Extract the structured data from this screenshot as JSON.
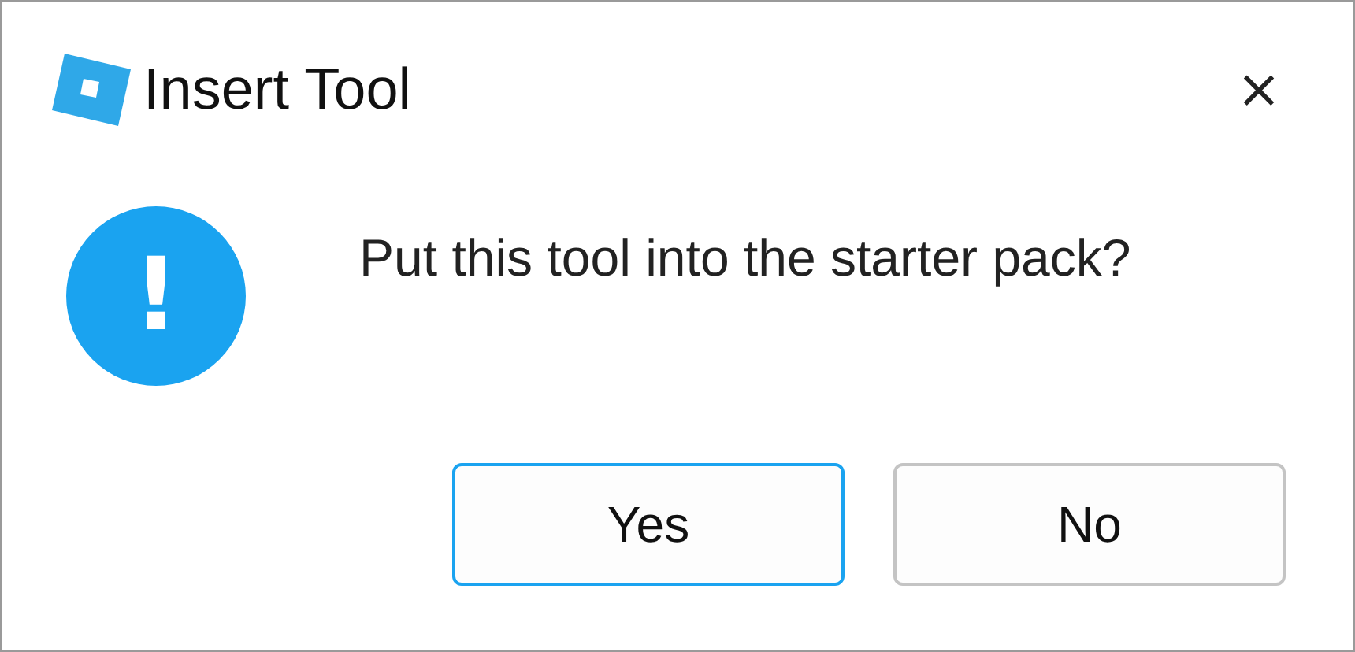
{
  "window": {
    "title": "Insert Tool",
    "close": "×"
  },
  "message": "Put this tool into the starter pack?",
  "icon": {
    "kind": "info",
    "glyph": "!"
  },
  "buttons": [
    {
      "label": "Yes",
      "default": true
    },
    {
      "label": "No",
      "default": false
    }
  ]
}
